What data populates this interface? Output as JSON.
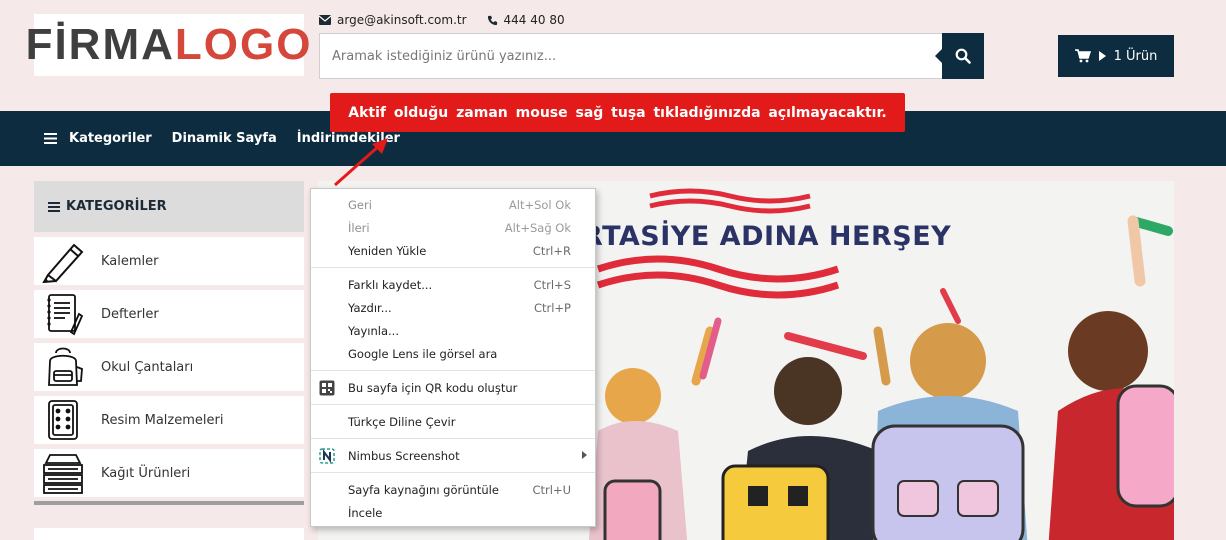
{
  "logo": {
    "part1": "FİRMA",
    "part2": "LOGO"
  },
  "contact": {
    "email": "arge@akinsoft.com.tr",
    "phone": "444 40 80"
  },
  "search": {
    "placeholder": "Aramak istediğiniz ürünü yazınız..."
  },
  "cart": {
    "label": "1 Ürün"
  },
  "nav": {
    "items": [
      "Kategoriler",
      "Dinamik Sayfa",
      "İndirimdekiler"
    ]
  },
  "tooltip": {
    "text": "Aktif olduğu zaman mouse sağ tuşa tıkladığınızda açılmayacaktır."
  },
  "sidebar": {
    "title": "KATEGORİLER",
    "items": [
      {
        "label": "Kalemler",
        "icon": "pencil-icon"
      },
      {
        "label": "Defterler",
        "icon": "notebook-icon"
      },
      {
        "label": "Okul Çantaları",
        "icon": "backpack-icon"
      },
      {
        "label": "Resim Malzemeleri",
        "icon": "paint-palette-icon"
      },
      {
        "label": "Kağıt Ürünleri",
        "icon": "paper-stack-icon"
      }
    ]
  },
  "banner": {
    "title": "RTASİYE ADINA HERŞEY"
  },
  "context_menu": {
    "items": [
      {
        "label": "Geri",
        "shortcut": "Alt+Sol Ok",
        "disabled": true
      },
      {
        "label": "İleri",
        "shortcut": "Alt+Sağ Ok",
        "disabled": true
      },
      {
        "label": "Yeniden Yükle",
        "shortcut": "Ctrl+R"
      },
      {
        "label": "Farklı kaydet...",
        "shortcut": "Ctrl+S"
      },
      {
        "label": "Yazdır...",
        "shortcut": "Ctrl+P"
      },
      {
        "label": "Yayınla..."
      },
      {
        "label": "Google Lens ile görsel ara"
      },
      {
        "label": "Bu sayfa için QR kodu oluştur",
        "icon": "qr-code-icon"
      },
      {
        "label": "Türkçe Diline Çevir"
      },
      {
        "label": "Nimbus Screenshot",
        "icon": "nimbus-icon"
      },
      {
        "label": "Sayfa kaynağını görüntüle",
        "shortcut": "Ctrl+U"
      },
      {
        "label": "İncele"
      }
    ]
  },
  "colors": {
    "navy": "#0d2c40",
    "alert_red": "#e31a1a",
    "page_bg": "#f6e9e9",
    "logo_red": "#d4473a"
  }
}
